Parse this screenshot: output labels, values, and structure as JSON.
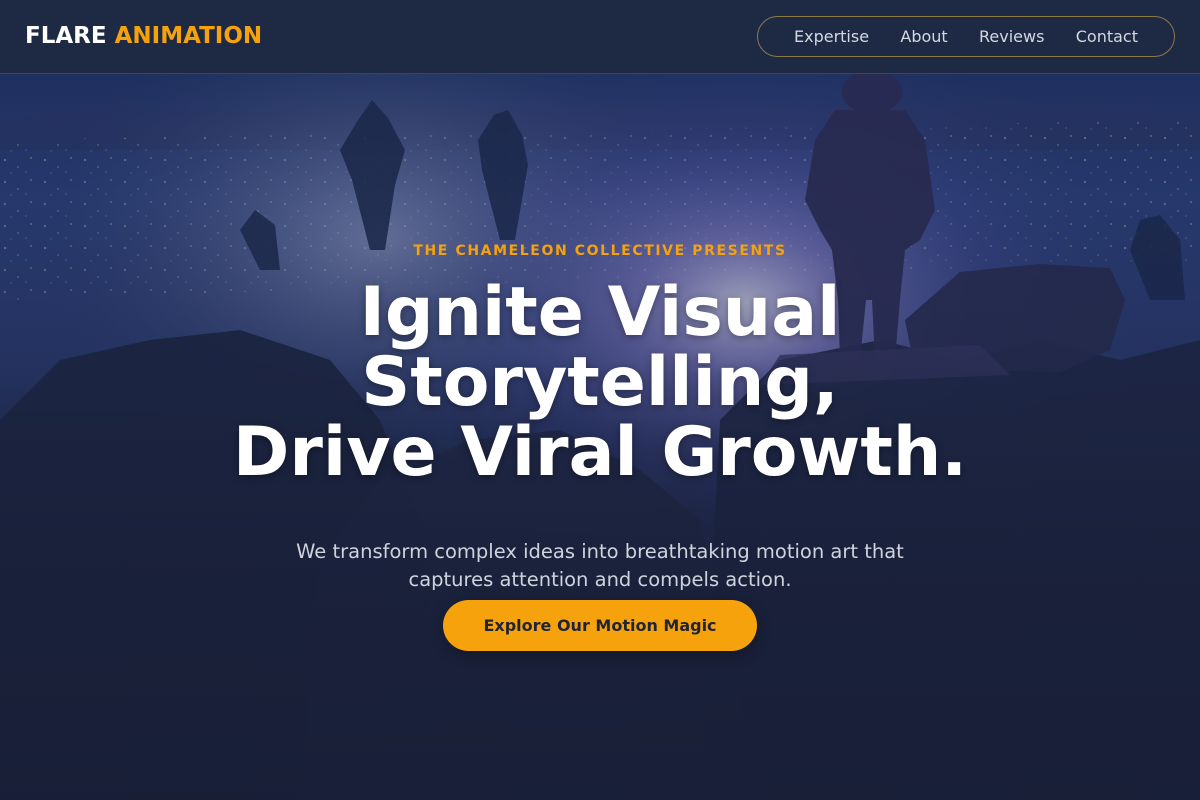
{
  "header": {
    "logo": {
      "word1": "FLARE",
      "word2": "ANIMATION"
    },
    "nav": [
      {
        "label": "Expertise"
      },
      {
        "label": "About"
      },
      {
        "label": "Reviews"
      },
      {
        "label": "Contact"
      }
    ]
  },
  "hero": {
    "eyebrow": "THE CHAMELEON COLLECTIVE PRESENTS",
    "headline_lines": [
      "Ignite Visual",
      "Storytelling,",
      "Drive Viral Growth."
    ],
    "subtext": "We transform complex ideas into breathtaking motion art that captures attention and compels action.",
    "cta_label": "Explore Our Motion Magic",
    "background_image": "night-landscape-with-armored-figure"
  },
  "colors": {
    "accent": "#f6a20c",
    "header_bg": "#1e2a44",
    "page_bg": "#1a2238",
    "text_light": "#ffffff",
    "text_muted": "#cfd3dc"
  }
}
